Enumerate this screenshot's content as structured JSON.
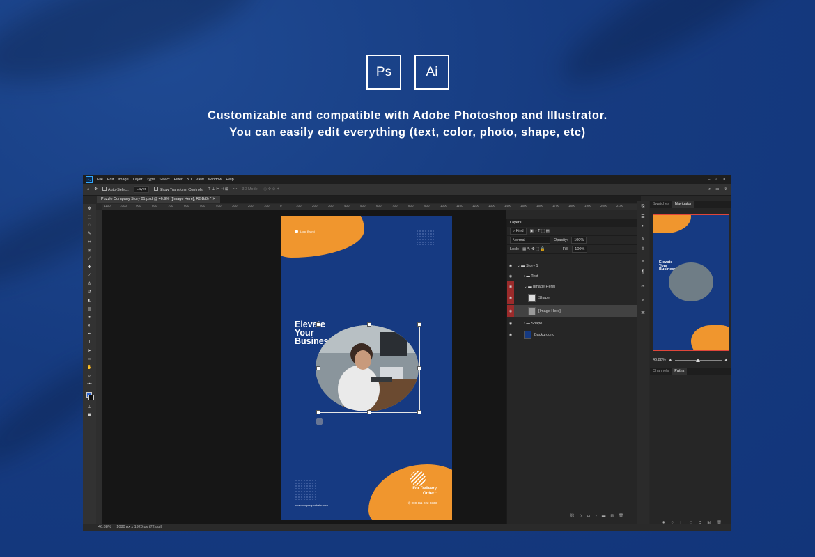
{
  "badges": [
    "Ps",
    "Ai"
  ],
  "headline": {
    "line1": "Customizable and compatible with Adobe Photoshop and Illustrator.",
    "line2": "You can easily edit everything (text, color, photo, shape, etc)"
  },
  "app": {
    "logo": "Ps",
    "menu": [
      "File",
      "Edit",
      "Image",
      "Layer",
      "Type",
      "Select",
      "Filter",
      "3D",
      "View",
      "Window",
      "Help"
    ],
    "options": {
      "auto_select": "Auto-Select:",
      "auto_select_value": "Layer",
      "show_transform": "Show Transform Controls",
      "mode_3d": "3D Mode:"
    },
    "doc_tab": "Puzzle Company Story 01.psd @ 46.9% ([Image Here], RGB/8) *",
    "ruler_ticks": [
      "1100",
      "1000",
      "900",
      "800",
      "700",
      "600",
      "500",
      "400",
      "300",
      "200",
      "100",
      "0",
      "100",
      "200",
      "300",
      "400",
      "500",
      "600",
      "700",
      "800",
      "900",
      "1000",
      "1100",
      "1200",
      "1300",
      "1400",
      "1500",
      "1600",
      "1700",
      "1800",
      "1900",
      "2000",
      "2100"
    ],
    "status": {
      "zoom": "46.88%",
      "dimensions": "1080 px x 1920 px (72 ppi)"
    }
  },
  "artboard": {
    "logo_text": "Logo Brand",
    "title": [
      "Elevate",
      "Your",
      "Business"
    ],
    "delivery": [
      "For Delivery",
      "Order :"
    ],
    "phone": "000-111-222-3333",
    "website": "www.companywebsite.com"
  },
  "layers_panel": {
    "tab": "Layers",
    "kind": "Kind",
    "blend_mode": "Normal",
    "opacity_label": "Opacity:",
    "opacity_value": "100%",
    "lock_label": "Lock:",
    "fill_label": "Fill:",
    "fill_value": "100%",
    "items": [
      {
        "name": "Story 1",
        "type": "group",
        "indent": 0,
        "eye_red": false
      },
      {
        "name": "Text",
        "type": "group",
        "indent": 1,
        "eye_red": false
      },
      {
        "name": "[Image Here]",
        "type": "group",
        "indent": 1,
        "eye_red": true
      },
      {
        "name": "Shape",
        "type": "layer",
        "indent": 2,
        "eye_red": true
      },
      {
        "name": "[Image Here]",
        "type": "layer",
        "indent": 2,
        "eye_red": true,
        "selected": true
      },
      {
        "name": "Shape",
        "type": "group",
        "indent": 1,
        "eye_red": false
      },
      {
        "name": "Background",
        "type": "layer",
        "indent": 1,
        "eye_red": false
      }
    ]
  },
  "navigator": {
    "tabs": [
      "Swatches",
      "Navigator"
    ],
    "zoom": "46.88%",
    "sub_tabs": [
      "Channels",
      "Paths"
    ]
  },
  "colors": {
    "background": "#163b80",
    "artboard": "#163a82",
    "accent_orange": "#f0962e",
    "eye_red": "#9b2b2b"
  }
}
